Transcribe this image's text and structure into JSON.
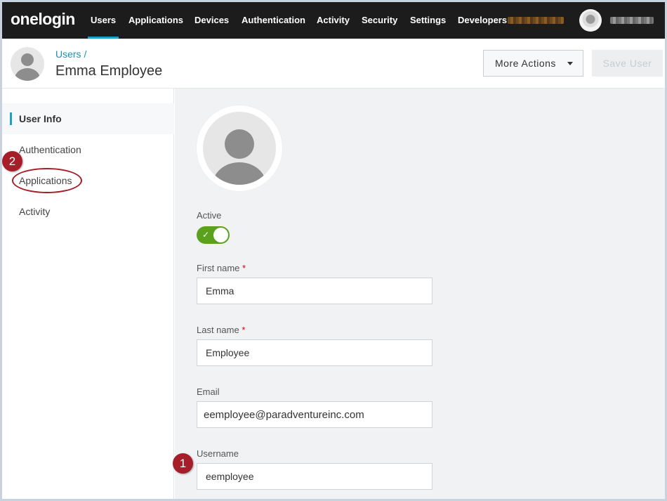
{
  "nav": {
    "logo": "onelogin",
    "items": [
      {
        "label": "Users",
        "active": true
      },
      {
        "label": "Applications"
      },
      {
        "label": "Devices"
      },
      {
        "label": "Authentication"
      },
      {
        "label": "Activity"
      },
      {
        "label": "Security"
      },
      {
        "label": "Settings"
      },
      {
        "label": "Developers"
      }
    ]
  },
  "header": {
    "breadcrumb": "Users",
    "breadcrumb_sep": "/",
    "title": "Emma Employee",
    "more_actions_label": "More Actions",
    "save_label": "Save User"
  },
  "sidebar": {
    "items": [
      {
        "label": "User Info",
        "active": true
      },
      {
        "label": "Authentication"
      },
      {
        "label": "Applications",
        "highlighted": true
      },
      {
        "label": "Activity"
      }
    ]
  },
  "markers": {
    "one": "1",
    "two": "2"
  },
  "form": {
    "active_label": "Active",
    "active_value": true,
    "required_mark": "*",
    "first_name_label": "First name",
    "first_name_value": "Emma",
    "last_name_label": "Last name",
    "last_name_value": "Employee",
    "email_label": "Email",
    "email_value": "eemployee@paradventureinc.com",
    "username_label": "Username",
    "username_value": "eemployee"
  },
  "colors": {
    "accent": "#1f9fc3",
    "nav_bg": "#1c1c1c",
    "toggle_on": "#5ba11d",
    "annotation": "#a51e2a",
    "required": "#d0021b"
  }
}
